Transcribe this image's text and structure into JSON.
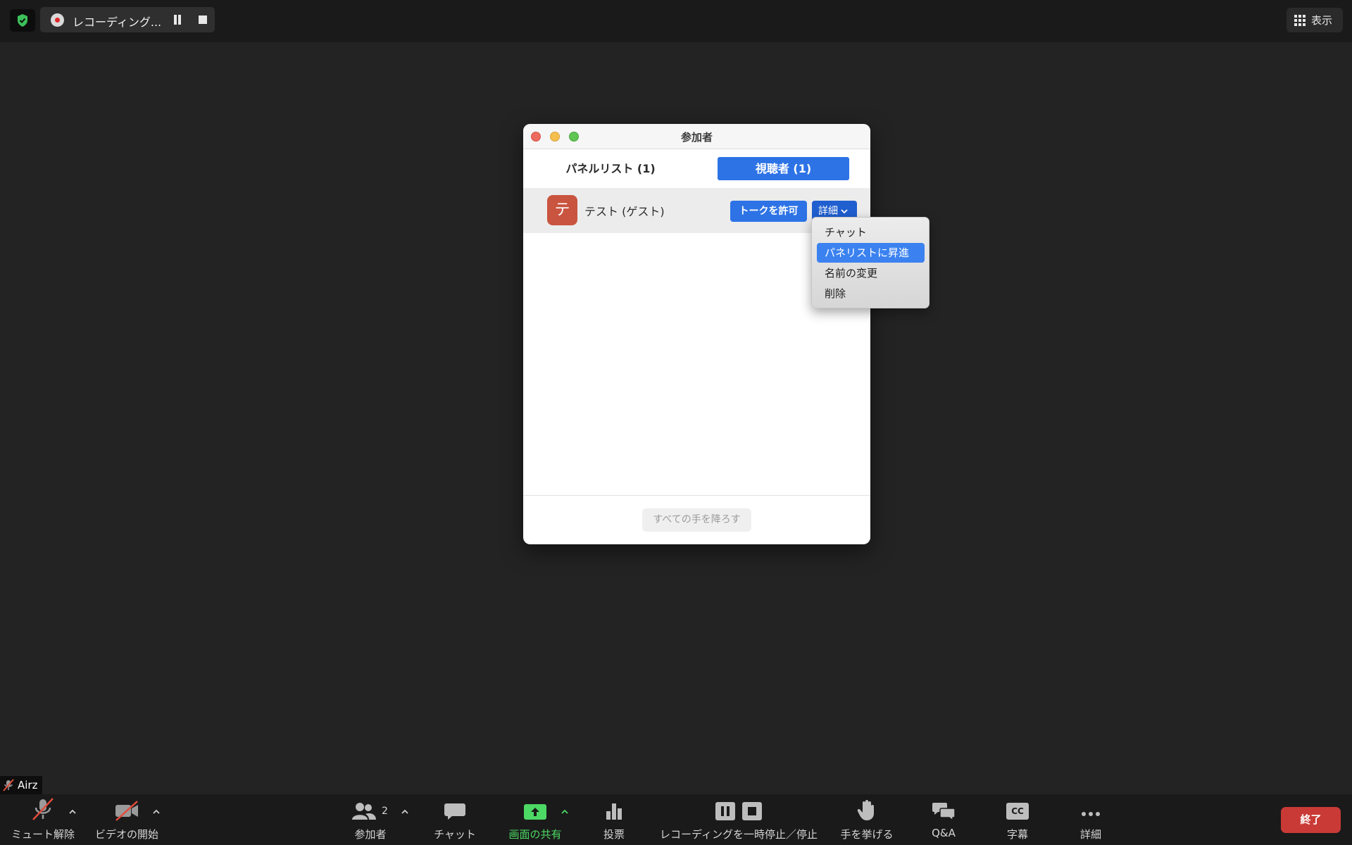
{
  "topbar": {
    "recording_label": "レコーディング...",
    "view_label": "表示"
  },
  "window": {
    "title": "参加者",
    "tabs": {
      "panelists": "パネルリスト (1)",
      "viewers": "視聴者 (1)"
    },
    "attendee": {
      "avatar_initial": "テ",
      "name": "テスト (ゲスト)",
      "allow_talk_label": "トークを許可",
      "more_label": "詳細"
    },
    "lower_all_hands_label": "すべての手を降ろす"
  },
  "menu": {
    "items": [
      {
        "label": "チャット",
        "highlighted": false
      },
      {
        "label": "パネリストに昇進",
        "highlighted": true
      },
      {
        "label": "名前の変更",
        "highlighted": false
      },
      {
        "label": "削除",
        "highlighted": false
      }
    ]
  },
  "name_tag": {
    "name": "Airz"
  },
  "toolbar": {
    "unmute_label": "ミュート解除",
    "start_video_label": "ビデオの開始",
    "participants_label": "参加者",
    "participants_count": "2",
    "chat_label": "チャット",
    "share_screen_label": "画面の共有",
    "polls_label": "投票",
    "recording_label": "レコーディングを一時停止／停止",
    "raise_hand_label": "手を挙げる",
    "qa_label": "Q&A",
    "captions_label": "字幕",
    "captions_icon_text": "CC",
    "more_label": "詳細",
    "end_label": "終了"
  },
  "colors": {
    "accent_blue": "#2d73e6",
    "share_green": "#4cd964",
    "end_red": "#c93a36",
    "avatar_red": "#c9543f"
  }
}
